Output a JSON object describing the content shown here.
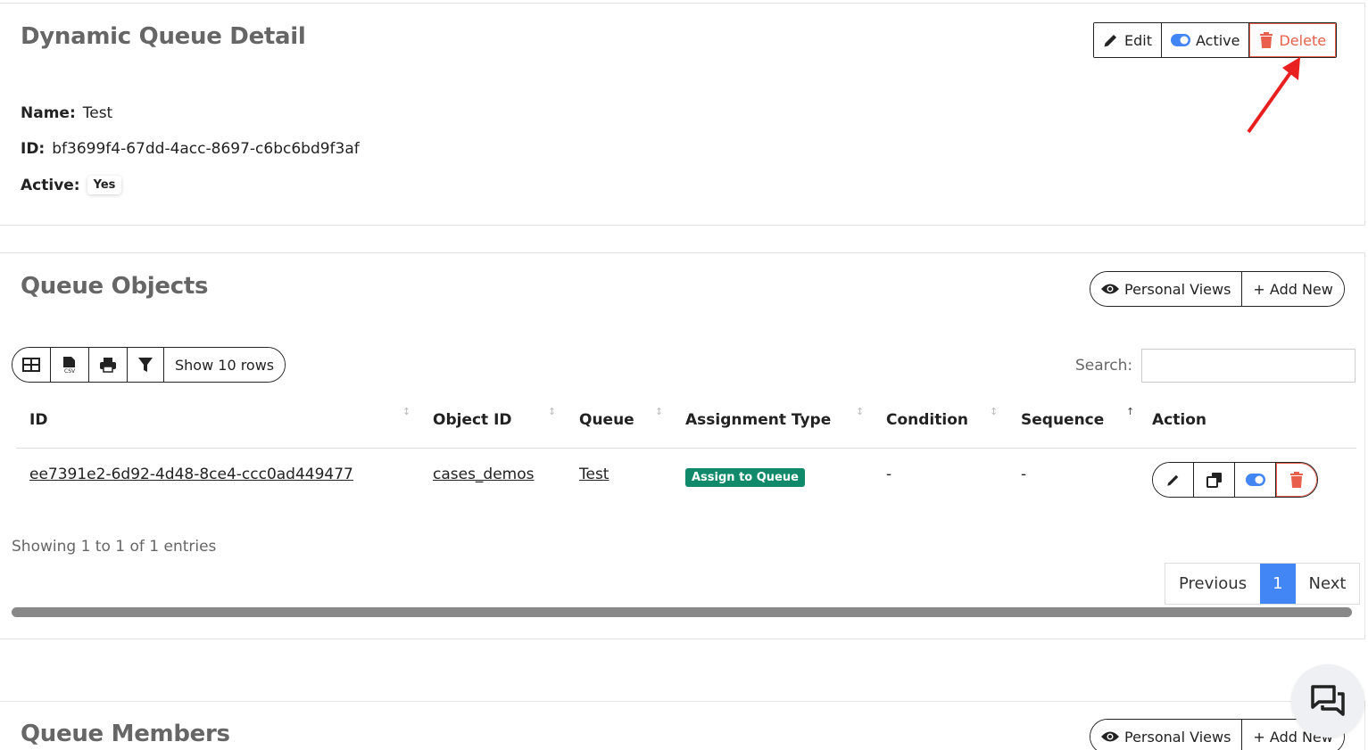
{
  "detail": {
    "title": "Dynamic Queue Detail",
    "buttons": {
      "edit": "Edit",
      "active": "Active",
      "delete": "Delete"
    },
    "fields": {
      "name_label": "Name:",
      "name_value": "Test",
      "id_label": "ID:",
      "id_value": "bf3699f4-67dd-4acc-8697-c6bc6bd9f3af",
      "active_label": "Active:",
      "active_value": "Yes"
    }
  },
  "queue_objects": {
    "title": "Queue Objects",
    "personal_views": "Personal Views",
    "add_new": "+ Add New",
    "toolbar": {
      "show_rows": "Show 10 rows"
    },
    "search_label": "Search:",
    "search_value": "",
    "columns": [
      "ID",
      "Object ID",
      "Queue",
      "Assignment Type",
      "Condition",
      "Sequence",
      "Action"
    ],
    "rows": [
      {
        "id": "ee7391e2-6d92-4d48-8ce4-ccc0ad449477",
        "object_id": "cases_demos",
        "queue": "Test",
        "assignment_type": "Assign to Queue",
        "condition": "-",
        "sequence": "-"
      }
    ],
    "showing": "Showing 1 to 1 of 1 entries",
    "pager": {
      "previous": "Previous",
      "current": "1",
      "next": "Next"
    }
  },
  "queue_members": {
    "title": "Queue Members",
    "personal_views": "Personal Views",
    "add_new": "+ Add New"
  },
  "colors": {
    "danger": "#e8604c",
    "primary": "#4285f4",
    "badge_green": "#118a6b",
    "arrow": "#e82020"
  },
  "icons": [
    "pencil-icon",
    "toggle-icon",
    "trash-icon",
    "eye-icon",
    "table-icon",
    "csv-icon",
    "print-icon",
    "filter-icon",
    "copy-icon",
    "chat-icon"
  ]
}
